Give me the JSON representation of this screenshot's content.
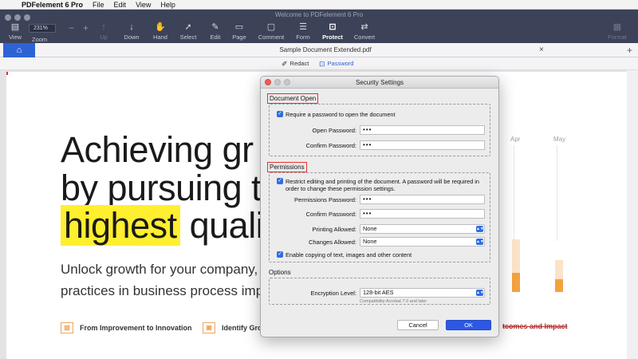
{
  "menubar": {
    "app_name": "PDFelement 6 Pro",
    "items": [
      "File",
      "Edit",
      "View",
      "Help"
    ]
  },
  "window": {
    "title": "Welcome to PDFelement 6 Pro"
  },
  "toolbar": {
    "zoom_value": "231%",
    "zoom_label": "Zoom",
    "view_label": "View",
    "up_label": "Up",
    "down_label": "Down",
    "hand_label": "Hand",
    "select_label": "Select",
    "edit_label": "Edit",
    "page_label": "Page",
    "comment_label": "Comment",
    "form_label": "Form",
    "protect_label": "Protect",
    "convert_label": "Convert",
    "format_label": "Format"
  },
  "tabs": {
    "document": "Sample Document Extended.pdf"
  },
  "subbar": {
    "redact": "Redact",
    "password": "Password"
  },
  "document": {
    "hero_line1": "Achieving gr",
    "hero_line2": "by pursuing t",
    "hero_line3_highlight": "highest",
    "hero_line3_rest": "quali",
    "sub_line1": "Unlock growth for your company, ado",
    "sub_line2": "practices in business process improve",
    "feature1": "From Improvement to Innovation",
    "feature2": "Identify Grow",
    "feature3": "tcomes and Impact",
    "chart_months": [
      "Apr",
      "May"
    ]
  },
  "dialog": {
    "title": "Security Settings",
    "document_open": {
      "heading": "Document Open",
      "require_label": "Require a password to open the document",
      "open_password_label": "Open Password:",
      "open_password_value": "•••",
      "confirm_password_label": "Confirm Password:",
      "confirm_password_value": "•••"
    },
    "permissions": {
      "heading": "Permissions",
      "restrict_label_line1": "Restrict editing and printing of the document. A password will be required in",
      "restrict_label_line2": "order to change these permission settings.",
      "permissions_password_label": "Permissions Password:",
      "permissions_password_value": "•••",
      "confirm_password_label": "Confirm Password:",
      "confirm_password_value": "•••",
      "printing_allowed_label": "Printing Allowed:",
      "printing_allowed_value": "None",
      "changes_allowed_label": "Changes Allowed:",
      "changes_allowed_value": "None",
      "enable_copying_label": "Enable copying of text, images and other content"
    },
    "options": {
      "heading": "Options",
      "encryption_label": "Encryption Level:",
      "encryption_value": "128-bit AES",
      "compatibility": "Compatibility:Acrobat 7.0 and later"
    },
    "cancel": "Cancel",
    "ok": "OK"
  },
  "colors": {
    "accent": "#2c58e3",
    "highlight": "#ffef2e",
    "toolbar_bg": "#3c4257",
    "red_box": "#e5322d"
  }
}
